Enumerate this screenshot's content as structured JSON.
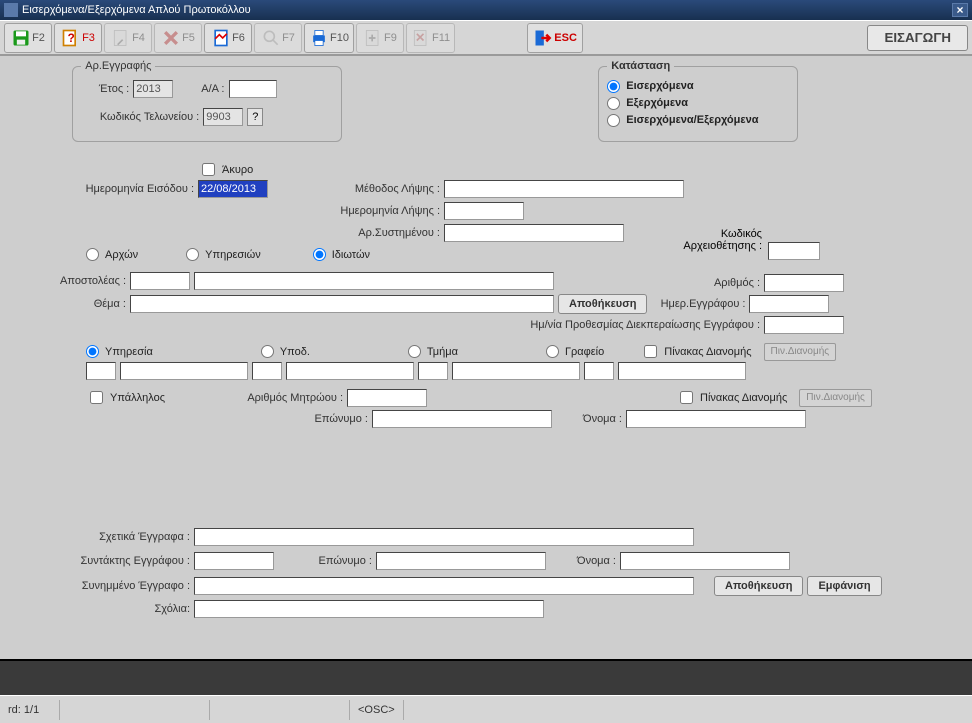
{
  "window": {
    "title": "Εισερχόμενα/Εξερχόμενα Απλού Πρωτοκόλλου"
  },
  "toolbar": {
    "f2": "F2",
    "f3": "F3",
    "f4": "F4",
    "f5": "F5",
    "f6": "F6",
    "f7": "F7",
    "f10": "F10",
    "f9": "F9",
    "f11": "F11",
    "esc": "ESC",
    "mode": "ΕΙΣΑΓΩΓΗ"
  },
  "reg": {
    "legend": "Αρ.Εγγραφής",
    "year_lbl": "Έτος :",
    "year": "2013",
    "aa_lbl": "Α/Α :",
    "aa": "",
    "customs_lbl": "Κωδικός Τελωνείου :",
    "customs": "9903",
    "q": "?"
  },
  "status": {
    "legend": "Κατάσταση",
    "opt_in": "Εισερχόμενα",
    "opt_out": "Εξερχόμενα",
    "opt_both": "Εισερχόμενα/Εξερχόμενα"
  },
  "fields": {
    "void_lbl": "Άκυρο",
    "entry_date_lbl": "Ημερομηνία Εισόδου :",
    "entry_date": "22/08/2013",
    "recv_method_lbl": "Μέθοδος Λήψης :",
    "recv_method": "",
    "recv_date_lbl": "Ημερομηνία Λήψης :",
    "recv_date": "",
    "sys_no_lbl": "Αρ.Συστημένου :",
    "sys_no": "",
    "arch_code_lbl": "Κωδικός Αρχειοθέτησης :",
    "arch_code": "",
    "number_lbl": "Αριθμός :",
    "number": "",
    "doc_date_lbl": "Ημερ.Εγγράφου :",
    "doc_date": "",
    "deadline_lbl": "Ημ/νία Προθεσμίας Διεκπεραίωσης Εγγράφου :",
    "deadline": "",
    "r_auth": "Αρχών",
    "r_serv": "Υπηρεσιών",
    "r_priv": "Ιδιωτών",
    "sender_lbl": "Αποστολέας :",
    "sender1": "",
    "sender2": "",
    "subject_lbl": "Θέμα :",
    "subject": "",
    "save_btn": "Αποθήκευση",
    "r2_service": "Υπηρεσία",
    "r2_subdiv": "Υποδ.",
    "r2_dept": "Τμήμα",
    "r2_office": "Γραφείο",
    "dist_tbl": "Πίνακας Διανομής",
    "dist_btn": "Πιν.Διανομής",
    "employee_lbl": "Υπάλληλος",
    "regno_lbl": "Αριθμός Μητρώου :",
    "regno": "",
    "surname_lbl": "Επώνυμο :",
    "surname": "",
    "name_lbl": "Όνομα :",
    "name": "",
    "related_lbl": "Σχετικά Έγγραφα :",
    "related": "",
    "author_lbl": "Συντάκτης Εγγράφου :",
    "author": "",
    "author_surname_lbl": "Επώνυμο :",
    "author_surname": "",
    "author_name_lbl": "Όνομα :",
    "author_name": "",
    "attached_lbl": "Συνημμένο Έγγραφο :",
    "attached": "",
    "save2_btn": "Αποθήκευση",
    "show_btn": "Εμφάνιση",
    "comments_lbl": "Σχόλια:",
    "comments": ""
  },
  "statusbar": {
    "record": "rd: 1/1",
    "osc": "<OSC>"
  }
}
